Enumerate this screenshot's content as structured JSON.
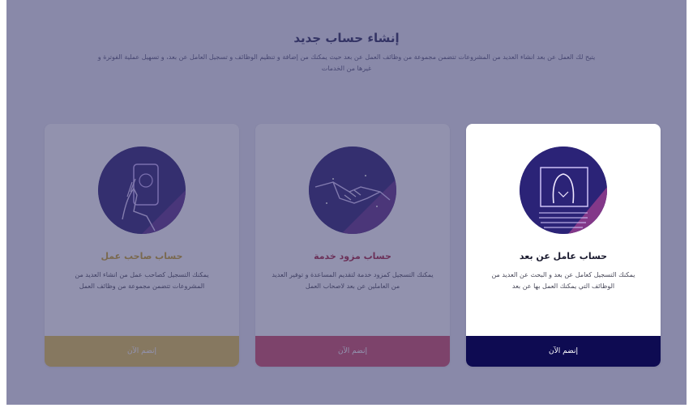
{
  "header": {
    "title": "إنشاء حساب جديد",
    "subtitle": "يتيح لك العمل عن بعد انشاء العديد من المشروعات تتضمن مجموعة من وظائف العمل عن بعد حيث يمكنك من إضافة و تنظيم الوظائف و تسجيل العامل عن بعد، و تسهيل عملية الفوترة و غيرها من الخدمات"
  },
  "cards": [
    {
      "title": "حساب صاحب عمل",
      "description": "يمكنك التسجيل كصاحب عمل من انشاء العديد من المشروعات تتضمن مجموعة من وظائف العمل",
      "button": "إنضم الآن",
      "title_color": "#c9a227",
      "button_color": "#e4c44f",
      "icon": "hand-holding-phone-icon"
    },
    {
      "title": "حساب مزود خدمة",
      "description": "يمكنك التسجيل كمزود خدمة لتقديم المساعدة و توفير العديد من العاملين عن بعد لاصحاب العمل",
      "button": "إنضم الآن",
      "title_color": "#a8243e",
      "button_color": "#d04b67",
      "icon": "handshake-icon"
    },
    {
      "title": "حساب عامل عن بعد",
      "description": "يمكنك التسجيل كعامل عن بعد و البحث عن العديد من الوظائف التي يمكنك العمل بها عن بعد",
      "button": "إنضم الآن",
      "title_color": "#1b1b2f",
      "button_color": "#0e0b52",
      "icon": "remote-worker-laptop-icon"
    }
  ]
}
